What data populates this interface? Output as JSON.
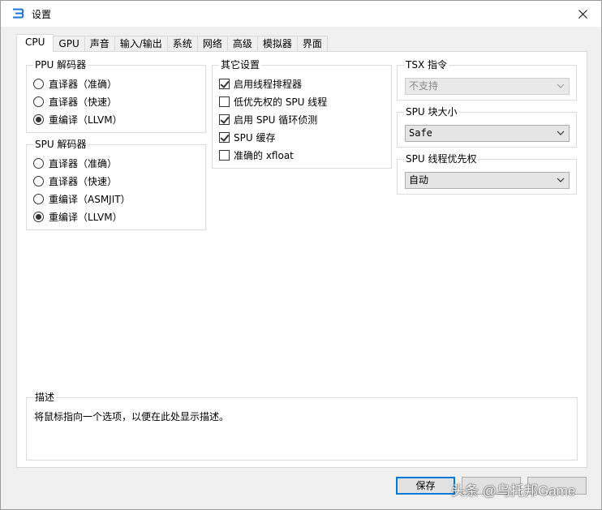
{
  "window": {
    "title": "设置"
  },
  "tabs": [
    "CPU",
    "GPU",
    "声音",
    "输入/输出",
    "系统",
    "网络",
    "高级",
    "模拟器",
    "界面"
  ],
  "ppu_decoder": {
    "title": "PPU 解码器",
    "options": [
      {
        "label": "直译器（准确）",
        "selected": false
      },
      {
        "label": "直译器（快速）",
        "selected": false
      },
      {
        "label": "重编译（LLVM）",
        "selected": true
      }
    ]
  },
  "spu_decoder": {
    "title": "SPU 解码器",
    "options": [
      {
        "label": "直译器（准确）",
        "selected": false
      },
      {
        "label": "直译器（快速）",
        "selected": false
      },
      {
        "label": "重编译（ASMJIT）",
        "selected": false
      },
      {
        "label": "重编译（LLVM）",
        "selected": true
      }
    ]
  },
  "other_settings": {
    "title": "其它设置",
    "options": [
      {
        "label": "启用线程排程器",
        "checked": true
      },
      {
        "label": "低优先权的 SPU 线程",
        "checked": false
      },
      {
        "label": "启用 SPU 循环侦测",
        "checked": true
      },
      {
        "label": "SPU 缓存",
        "checked": true
      },
      {
        "label": "准确的 xfloat",
        "checked": false
      }
    ]
  },
  "tsx": {
    "title": "TSX 指令",
    "value": "不支持",
    "disabled": true
  },
  "spu_block_size": {
    "title": "SPU 块大小",
    "value": "Safe"
  },
  "spu_thread_priority": {
    "title": "SPU 线程优先权",
    "value": "自动"
  },
  "description": {
    "title": "描述",
    "text": "将鼠标指向一个选项，以便在此处显示描述。"
  },
  "buttons": {
    "save": "保存"
  },
  "watermark": "头条 @乌托邦Game"
}
